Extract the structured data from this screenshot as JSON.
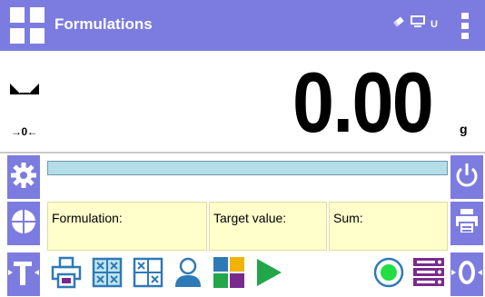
{
  "header": {
    "title": "Formulations",
    "usb_indicator": "U",
    "icons": [
      "menu-grid-icon",
      "eraser-icon",
      "display-icon",
      "more-vert-icon"
    ]
  },
  "display": {
    "value": "0.00",
    "unit": "g",
    "zero_indicator": "→0←",
    "progress": 0
  },
  "info": {
    "formulation_label": "Formulation:",
    "target_label": "Target value:",
    "sum_label": "Sum:"
  },
  "left_buttons": [
    "settings-gear-icon",
    "pie-quarters-icon",
    "tare-icon"
  ],
  "right_buttons": [
    "power-icon",
    "print-icon",
    "zeroing-icon"
  ],
  "toolbar": [
    "print-record-icon",
    "formula-grid-icon",
    "formula-grid-icon-2",
    "user-icon",
    "databases-icon",
    "start-icon",
    "record-icon",
    "server-icon"
  ],
  "colors": {
    "accent": "#7c7ce0",
    "info_fill": "#ffffcc",
    "progress_fill": "#b4dde8",
    "toolbar_blue": "#2e7ab6",
    "play_green": "#22a64a",
    "server_purple": "#7a2a8c"
  }
}
